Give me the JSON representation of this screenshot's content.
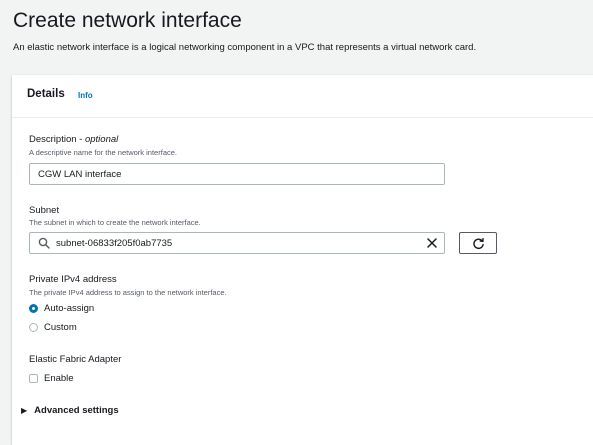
{
  "page": {
    "title": "Create network interface",
    "description": "An elastic network interface is a logical networking component in a VPC that represents a virtual network card."
  },
  "details": {
    "title": "Details",
    "info_link": "Info",
    "description_field": {
      "label": "Description",
      "optional": "- optional",
      "hint": "A descriptive name for the network interface.",
      "value": "CGW LAN interface"
    },
    "subnet_field": {
      "label": "Subnet",
      "hint": "The subnet in which to create the network interface.",
      "value": "subnet-06833f205f0ab7735",
      "search_icon": "search-icon",
      "clear_icon": "close-icon",
      "refresh_icon": "refresh-icon"
    },
    "private_ipv4": {
      "label": "Private IPv4 address",
      "hint": "The private IPv4 address to assign to the network interface.",
      "options": [
        {
          "label": "Auto-assign",
          "selected": true
        },
        {
          "label": "Custom",
          "selected": false
        }
      ]
    },
    "efa": {
      "label": "Elastic Fabric Adapter",
      "checkbox_label": "Enable",
      "checked": false
    },
    "advanced_settings": {
      "label": "Advanced settings",
      "expanded": false
    }
  },
  "colors": {
    "accent": "#0073bb",
    "background": "#f2f3f3",
    "text": "#16191f",
    "hint_text": "#545b64",
    "border": "#aab7b8"
  }
}
